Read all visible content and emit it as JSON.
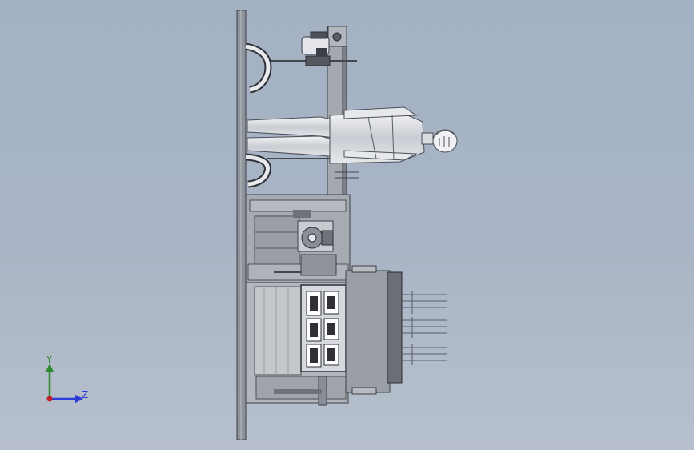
{
  "viewport": {
    "background_top": "#a3b1c4",
    "background_bottom": "#b7c0cc"
  },
  "triad": {
    "y_label": "Y",
    "z_label": "Z",
    "y_color": "#2d8a2d",
    "z_color": "#2b3bd8",
    "origin_color": "#c0202a"
  },
  "model": {
    "components": [
      "base-plate",
      "frame-column",
      "motor-unit",
      "human-figure",
      "control-cabinet",
      "gear-unit",
      "rack-assembly",
      "probe-array"
    ]
  }
}
